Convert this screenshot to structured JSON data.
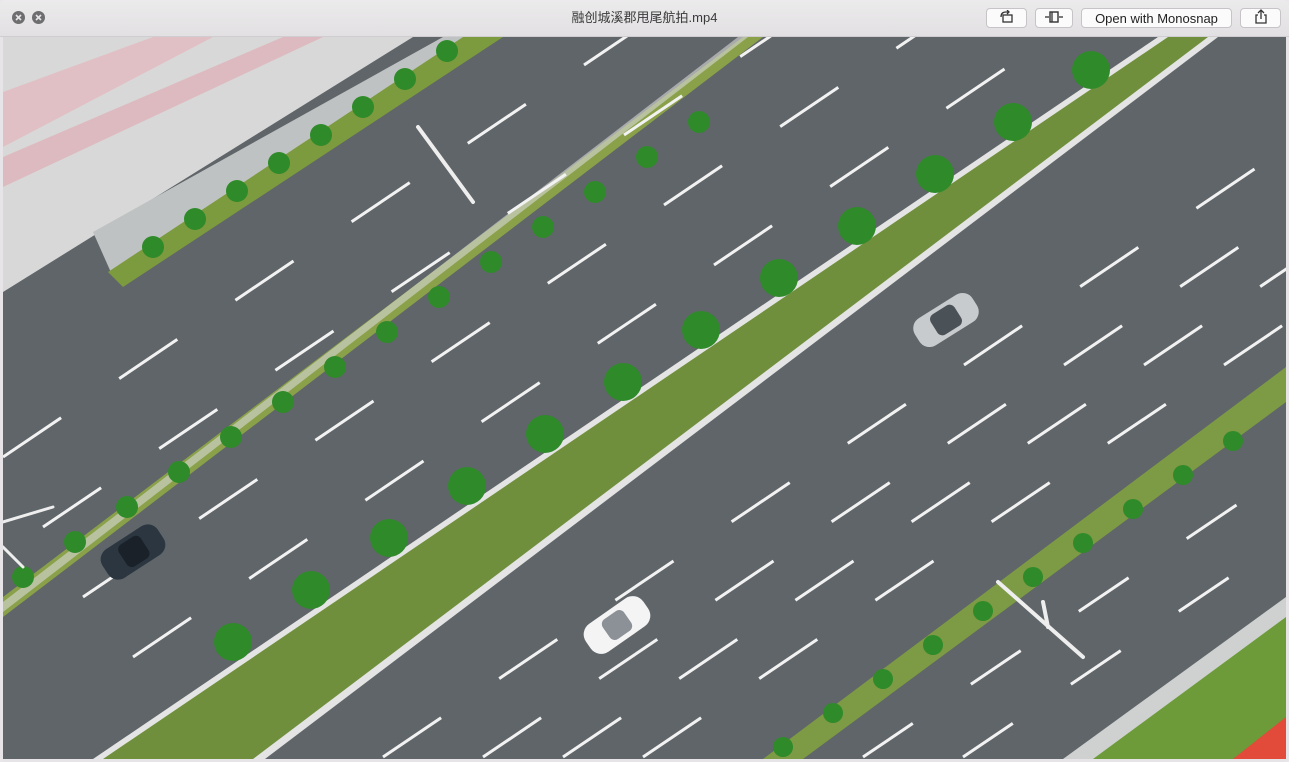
{
  "window": {
    "title": "融创城溪郡甩尾航拍.mp4"
  },
  "toolbar": {
    "open_with_label": "Open with Monosnap"
  },
  "icons": {
    "close": "close-icon",
    "fullscreen": "fullscreen-icon",
    "rotate": "rotate-icon",
    "trim": "trim-icon",
    "share": "share-icon"
  },
  "colors": {
    "asphalt": "#5f6568",
    "lane_marking": "#f2f2f2",
    "median_grass": "#6f8f3c",
    "tree": "#2f8a2a",
    "sidewalk": "#d9d9d9",
    "sidewalk_stripe": "#e2a3ad"
  }
}
